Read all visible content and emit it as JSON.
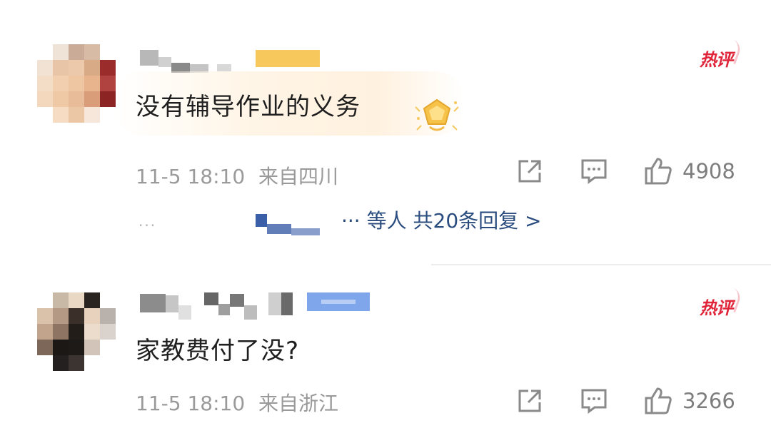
{
  "comments": [
    {
      "text": "没有辅导作业的义务",
      "hot_label": "热评",
      "time": "11-5 18:10",
      "location": "来自四川",
      "likes": "4908",
      "replies_summary": "··· 等人 共20条回复 >",
      "more_dots": "···",
      "icons": [
        "share-icon",
        "reply-icon",
        "like-thumb-icon",
        "medal-badge-icon"
      ],
      "accent": "#e0253b",
      "badge_color": "#f6c24a"
    },
    {
      "text": "家教费付了没?",
      "hot_label": "热评",
      "time": "11-5 18:10",
      "location": "来自浙江",
      "likes": "3266",
      "icons": [
        "share-icon",
        "reply-icon",
        "like-thumb-icon"
      ],
      "accent": "#e0253b",
      "badge_color": "#7fa6ea"
    }
  ]
}
